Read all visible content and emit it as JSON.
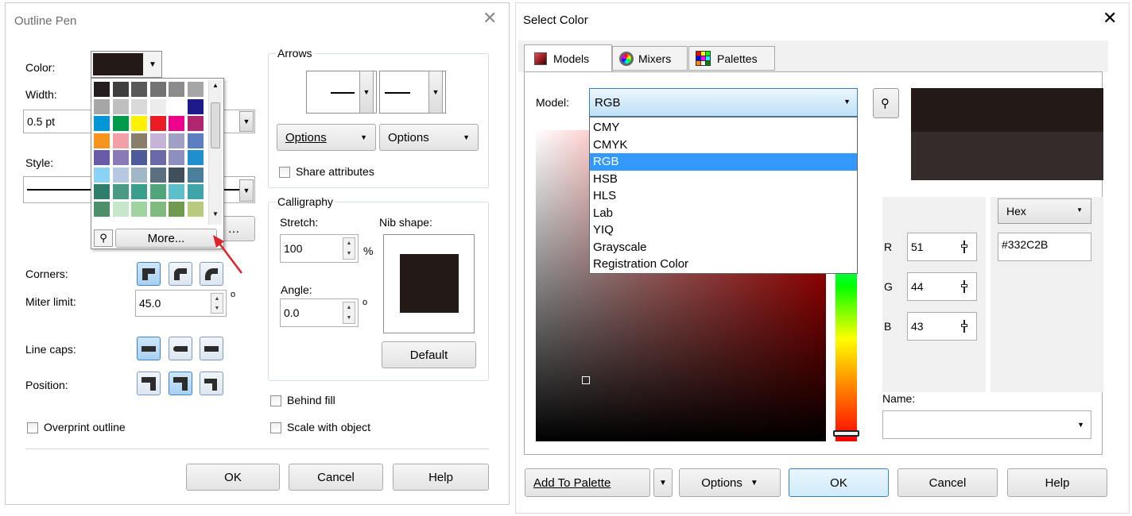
{
  "outline_pen": {
    "title": "Outline Pen",
    "labels": {
      "color": "Color:",
      "width": "Width:",
      "style": "Style:",
      "corners": "Corners:",
      "miter_limit": "Miter limit:",
      "line_caps": "Line caps:",
      "position": "Position:"
    },
    "width_value": "0.5 pt",
    "miter_value": "45.0",
    "degree_symbol": "o",
    "overprint_label": "Overprint outline",
    "color_value": "#231a17",
    "palette_more_label": "More...",
    "palette_colors": [
      "#231f20",
      "#3f3f3f",
      "#595959",
      "#737373",
      "#8c8c8c",
      "#a6a6a6",
      "#a6a6a6",
      "#bfbfbf",
      "#d9d9d9",
      "#ececec",
      "#ffffff",
      "#1f1a8c",
      "#0096d8",
      "#009b4a",
      "#fff200",
      "#ed1c24",
      "#ec008c",
      "#b0256d",
      "#f7941d",
      "#f0a0a6",
      "#8b7d6b",
      "#c6b4d8",
      "#a09fc6",
      "#5b7ec1",
      "#6a5ba6",
      "#8b7ab8",
      "#4e5b9b",
      "#6a6aa8",
      "#8f8fbf",
      "#1f8fcd",
      "#8bd3f5",
      "#b7c9e2",
      "#9fb7c6",
      "#5a6f80",
      "#3f4f5c",
      "#4a7f9a",
      "#2f7e6b",
      "#4a9a86",
      "#3a9f8a",
      "#4fa67a",
      "#5bc0cc",
      "#3fa5a9",
      "#4c8f6a",
      "#c8e6c9",
      "#9fd39f",
      "#7fba7f",
      "#6f9a4f",
      "#b9c97f"
    ],
    "arrows": {
      "group_label": "Arrows",
      "options_left": "Options",
      "options_right": "Options",
      "share_attributes": "Share attributes"
    },
    "calligraphy": {
      "group_label": "Calligraphy",
      "stretch_label": "Stretch:",
      "stretch_value": "100",
      "percent": "%",
      "nib_shape_label": "Nib shape:",
      "angle_label": "Angle:",
      "angle_value": "0.0",
      "degree_symbol": "o",
      "default_button": "Default"
    },
    "behind_fill": "Behind fill",
    "scale_with_object": "Scale with object",
    "buttons": {
      "ok": "OK",
      "cancel": "Cancel",
      "help": "Help"
    }
  },
  "select_color": {
    "title": "Select Color",
    "tabs": [
      {
        "label": "Models",
        "icon": "models-icon",
        "active": true
      },
      {
        "label": "Mixers",
        "icon": "mixers-icon",
        "active": false
      },
      {
        "label": "Palettes",
        "icon": "palettes-icon",
        "active": false
      }
    ],
    "model_label": "Model:",
    "model_value": "RGB",
    "model_options": [
      "CMY",
      "CMYK",
      "RGB",
      "HSB",
      "HLS",
      "Lab",
      "YIQ",
      "Grayscale",
      "Registration Color"
    ],
    "model_selected_index": 2,
    "preview_old_color": "#231a17",
    "preview_new_color": "#332c2b",
    "format_value": "Hex",
    "channels": [
      {
        "label": "R",
        "value": "51"
      },
      {
        "label": "G",
        "value": "44"
      },
      {
        "label": "B",
        "value": "43"
      }
    ],
    "hex_value": "#332C2B",
    "name_label": "Name:",
    "name_value": "",
    "buttons": {
      "add_to_palette": "Add To Palette",
      "options": "Options",
      "ok": "OK",
      "cancel": "Cancel",
      "help": "Help"
    }
  }
}
